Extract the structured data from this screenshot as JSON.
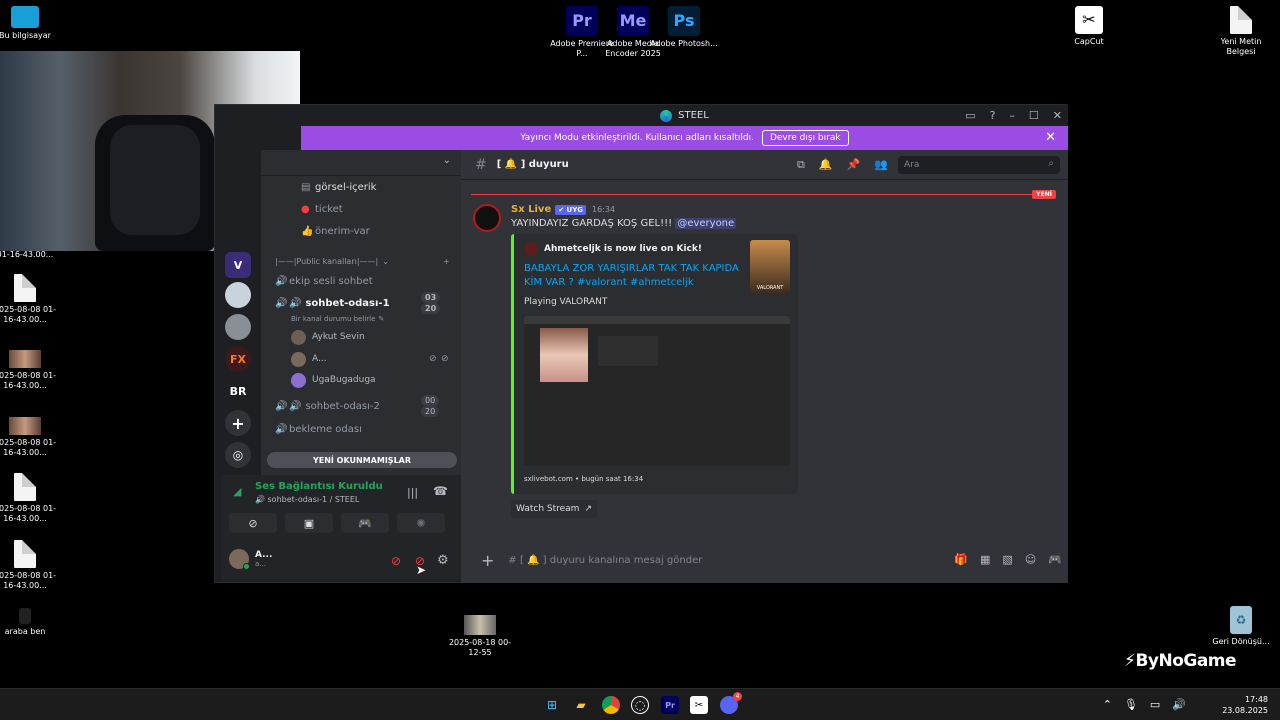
{
  "desktop": {
    "icons_top": [
      {
        "label": "Bu bilgisayar",
        "glyph": "PC"
      },
      {
        "label": "Adobe Premiere P...",
        "glyph": "Pr",
        "color": "#9999ff",
        "bg": "#00005b"
      },
      {
        "label": "Adobe Media Encoder 2025",
        "glyph": "Me",
        "color": "#9999ff",
        "bg": "#00005b"
      },
      {
        "label": "Adobe Photosh...",
        "glyph": "Ps",
        "color": "#31a8ff",
        "bg": "#001e36"
      },
      {
        "label": "CapCut",
        "glyph": "✂"
      },
      {
        "label": "Yeni Metin Belgesi",
        "glyph": ""
      }
    ],
    "icons_left": [
      {
        "label": "01-16-43.00..."
      },
      {
        "label": "2025-08-08 01-16-43.00..."
      },
      {
        "label": "2025-08-08 01-16-43.00..."
      },
      {
        "label": "2025-08-08 01-16-43.00..."
      },
      {
        "label": "2025-08-08 01-16-43.00..."
      },
      {
        "label": "2025-08-08 01-16-43.00..."
      },
      {
        "label": "araba ben"
      }
    ],
    "icon_video": {
      "label": "2025-08-18 00-12-55"
    },
    "icon_recycle": {
      "label": "Geri Dönüşü..."
    },
    "watermark": "ByNoGame"
  },
  "window": {
    "title": "STEEL",
    "banner_text": "Yayıncı Modu etkinleştirildi. Kullanıcı adları kısaltıldı.",
    "banner_button": "Devre dışı bırak"
  },
  "servers": [
    "BR"
  ],
  "sidebar": {
    "channels": [
      {
        "icon": "#",
        "name": "görsel-içerik"
      },
      {
        "icon": "#",
        "name": "ticket"
      },
      {
        "icon": "#",
        "name": "önerim-var"
      }
    ],
    "category": "|——|Public kanalları|——|",
    "voice": [
      {
        "name": "ekip sesli sohbet"
      },
      {
        "name": "sohbet-odası-1",
        "count": "03",
        "limit": "20",
        "status": "Bir kanal durumu belirle"
      },
      {
        "name": "sohbet-odası-2",
        "count": "00",
        "limit": "20"
      },
      {
        "name": "bekleme odası"
      }
    ],
    "members": [
      "Aykut Sevin",
      "A...",
      "UgaBugaduga"
    ],
    "unread_label": "YENİ OKUNMAMIŞLAR"
  },
  "voice_panel": {
    "status": "Ses Bağlantısı Kuruldu",
    "sub": "sohbet-odası-1 / STEEL",
    "user_name": "A...",
    "user_sub": "a..."
  },
  "chat": {
    "channel": "[ 🔔 ] duyuru",
    "search_placeholder": "Ara",
    "new_tag": "YENİ",
    "author": "Sx Live",
    "author_tag": "✔ UYG",
    "time": "16:34",
    "text": "YAYINDAYIZ GARDAŞ KOŞ GEL!!!",
    "mention": "@everyone",
    "embed": {
      "author": "Ahmetceljk is now live on Kick!",
      "title": "BABAYLA ZOR YARIŞIRLAR TAK TAK KAPIDA KİM VAR ? #valorant #ahmetceljk",
      "desc": "Playing VALORANT",
      "thumb_label": "VALORANT",
      "footer": "sxlivebot.com • bugün saat 16:34"
    },
    "watch_label": "Watch Stream",
    "composer_placeholder": "# [ 🔔 ]  duyuru kanalına mesaj gönder"
  },
  "taskbar": {
    "time": "17:48",
    "date": "23.08.2025",
    "discord_badge": "4"
  }
}
